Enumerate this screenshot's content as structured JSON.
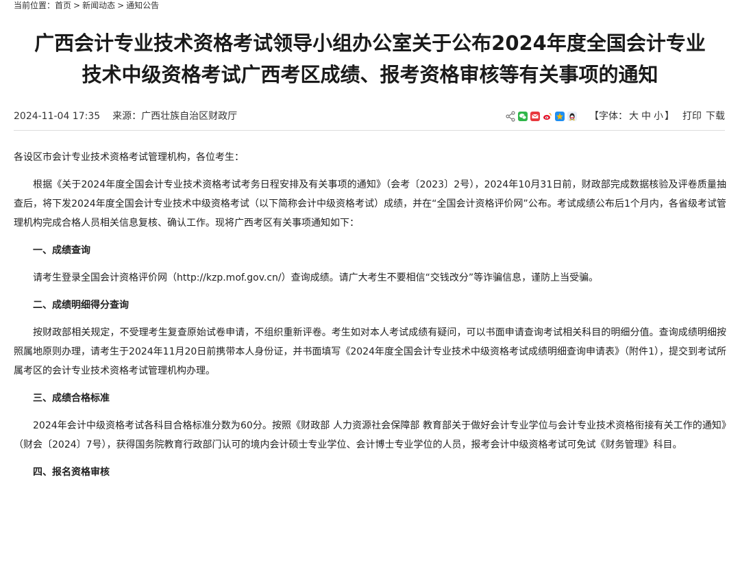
{
  "breadcrumb": {
    "prefix": "当前位置：",
    "items": [
      "首页",
      "新闻动态",
      "通知公告"
    ],
    "separator": ">"
  },
  "article": {
    "title_line1": "广西会计专业技术资格考试领导小组办公室关于公布2024年度全国会计专业",
    "title_line2": "技术中级资格考试广西考区成绩、报考资格审核等有关事项的通知",
    "datetime": "2024-11-04 17:35",
    "source_label": "来源：",
    "source": "广西壮族自治区财政厅"
  },
  "toolbar": {
    "font_open": "【字体：",
    "font_large": "大",
    "font_medium": "中",
    "font_small": "小",
    "font_close": "】",
    "print": "打印",
    "download": "下载",
    "share_icons": [
      "share-icon",
      "wechat-icon",
      "email-icon",
      "weibo-icon",
      "qzone-icon",
      "qq-icon"
    ]
  },
  "body": {
    "greeting": "各设区市会计专业技术资格考试管理机构，各位考生：",
    "intro": "根据《关于2024年度全国会计专业技术资格考试考务日程安排及有关事项的通知》（会考〔2023〕2号），2024年10月31日前，财政部完成数据核验及评卷质量抽查后，将下发2024年度全国会计专业技术中级资格考试（以下简称会计中级资格考试）成绩，并在“全国会计资格评价网”公布。考试成绩公布后1个月内，各省级考试管理机构完成合格人员相关信息复核、确认工作。现将广西考区有关事项通知如下：",
    "sections": [
      {
        "heading": "一、成绩查询",
        "text": "请考生登录全国会计资格评价网（http://kzp.mof.gov.cn/）查询成绩。请广大考生不要相信“交钱改分”等诈骗信息，谨防上当受骗。"
      },
      {
        "heading": "二、成绩明细得分查询",
        "text": "按财政部相关规定，不受理考生复查原始试卷申请，不组织重新评卷。考生如对本人考试成绩有疑问，可以书面申请查询考试相关科目的明细分值。查询成绩明细按照属地原则办理，请考生于2024年11月20日前携带本人身份证，并书面填写《2024年度全国会计专业技术中级资格考试成绩明细查询申请表》（附件1），提交到考试所属考区的会计专业技术资格考试管理机构办理。"
      },
      {
        "heading": "三、成绩合格标准",
        "text": "2024年会计中级资格考试各科目合格标准分数为60分。按照《财政部 人力资源社会保障部 教育部关于做好会计专业学位与会计专业技术资格衔接有关工作的通知》（财会〔2024〕7号），获得国务院教育行政部门认可的境内会计硕士专业学位、会计博士专业学位的人员，报考会计中级资格考试可免试《财务管理》科目。"
      },
      {
        "heading": "四、报名资格审核",
        "text": ""
      }
    ]
  },
  "colors": {
    "wechat": "#2fb64a",
    "email": "#e8383d",
    "weibo": "#e6162d",
    "qzone": "#f5b800",
    "qq": "#1f8ef1",
    "divider": "#dcdcdc"
  }
}
